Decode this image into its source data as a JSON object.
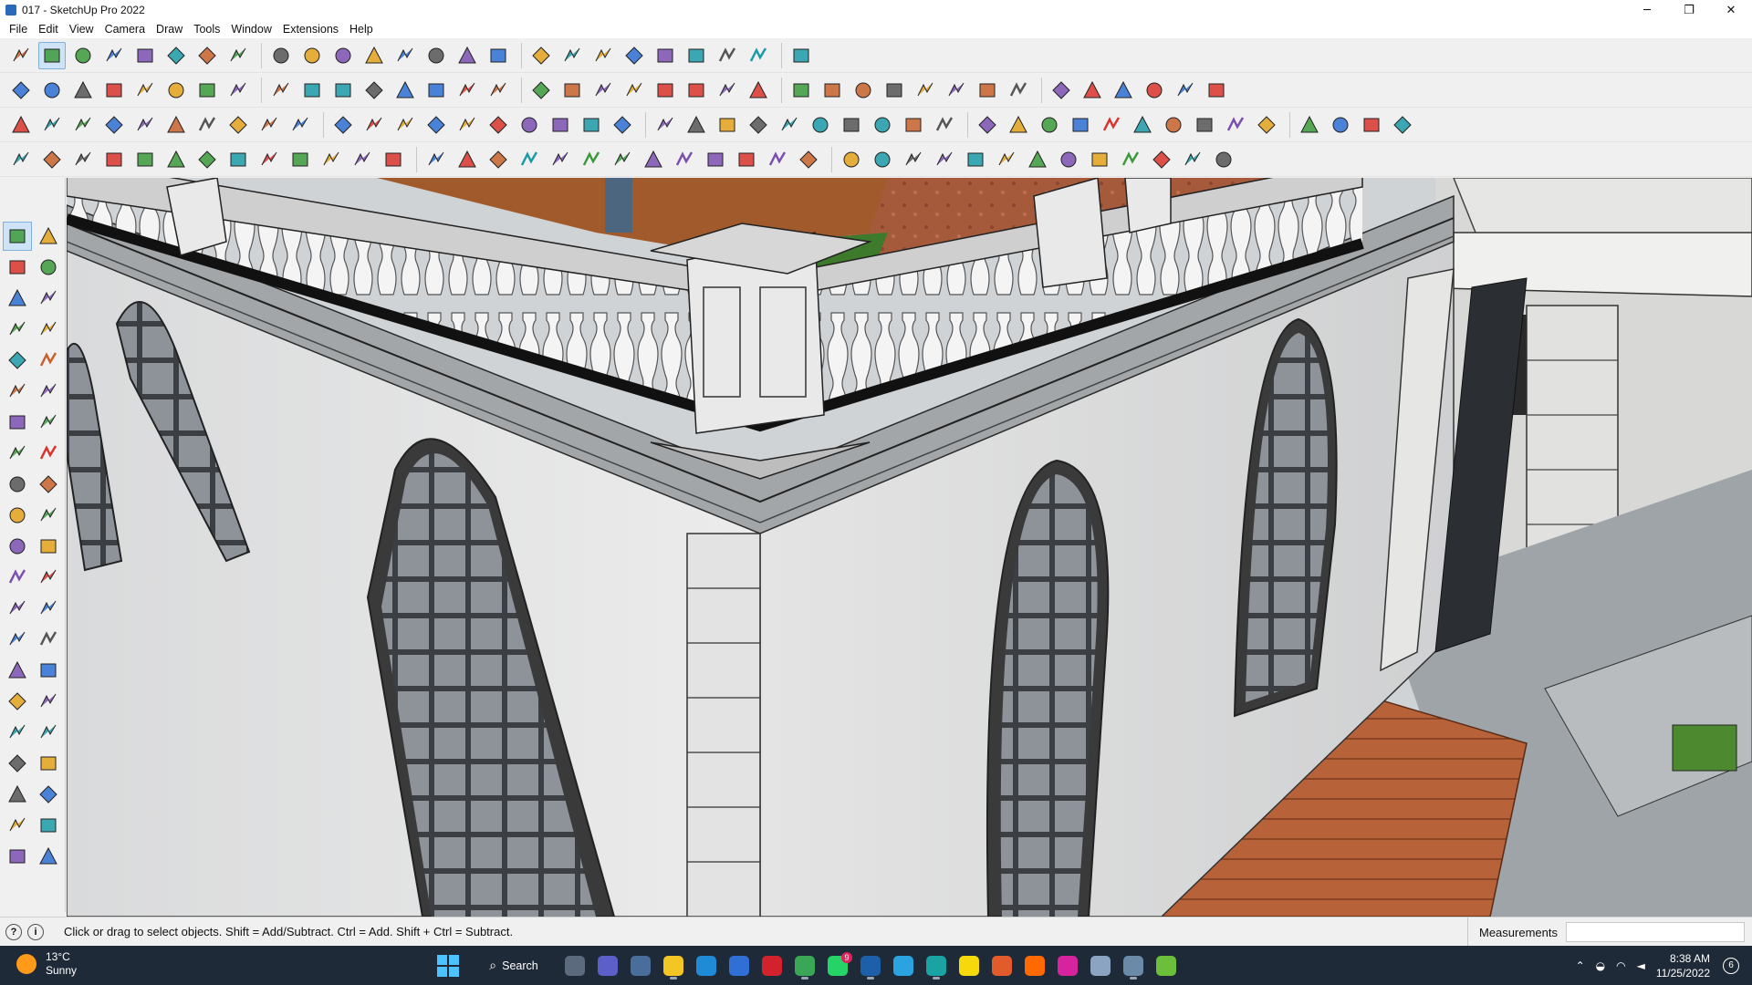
{
  "window": {
    "title": "017 - SketchUp Pro 2022",
    "minimize_glyph": "─",
    "maximize_glyph": "❐",
    "close_glyph": "✕"
  },
  "menu": [
    "File",
    "Edit",
    "View",
    "Camera",
    "Draw",
    "Tools",
    "Window",
    "Extensions",
    "Help"
  ],
  "toolbars": {
    "row1": [
      "search-icon",
      "select-icon",
      "eraser-icon",
      "pencil-icon",
      "arc-icon",
      "rectangle-icon",
      "push-pull-icon",
      "follow-me-icon",
      "move-icon",
      "rotate-icon",
      "scale-icon",
      "tape-measure-icon",
      "text-icon",
      "paint-bucket-icon",
      "orbit-icon",
      "pan-icon",
      "zoom-icon",
      "zoom-extents-icon",
      "warehouse-icon",
      "extension-warehouse-icon",
      "layout-icon",
      "extension-manager-icon",
      "profile-icon",
      "sandbox-icon",
      "dynamic-component-icon"
    ],
    "row2": [
      "iso-view-icon",
      "top-view-icon",
      "front-view-icon",
      "right-view-icon",
      "back-view-icon",
      "left-view-icon",
      "section-plane-icon",
      "xray-icon",
      "wireframe-icon",
      "hidden-line-icon",
      "shaded-icon",
      "textured-icon",
      "monochrome-icon",
      "solid-union-icon",
      "solid-subtract-icon",
      "shape-rect-icon",
      "shape-circle-icon",
      "shape-poly-icon",
      "shape-ellipse-icon",
      "shape-parallelogram-icon",
      "shape-arc-icon",
      "shape-oval-icon",
      "shape-leaf-icon",
      "shape-star-icon",
      "shape-ring-icon",
      "shape-line-icon",
      "shape-eraser-icon",
      "axes-red-icon",
      "axes-green-icon",
      "axes-blue-icon",
      "axes-x-icon",
      "axes-y-icon",
      "axes-z-icon",
      "axes-n-icon",
      "axes-e-icon",
      "axes-f-icon",
      "terrain-icon",
      "tree-icon"
    ],
    "row3": [
      "component-options-icon",
      "component-attributes-icon",
      "generate-report-icon",
      "dimensions-icon",
      "protractor-icon",
      "axes-tool-icon",
      "3d-text-icon",
      "section-fill-icon",
      "outliner-icon",
      "cube-icon",
      "sphere-icon",
      "cylinder-icon",
      "cone-icon",
      "torus-icon",
      "shadows-icon",
      "fog-icon",
      "styles-icon",
      "layers-icon",
      "scenes-icon",
      "camera-icon",
      "match-photo-icon",
      "walk-icon",
      "look-around-icon",
      "position-camera-icon",
      "curve-icon",
      "bezier-icon",
      "spline-icon",
      "tools-a-icon",
      "tools-b-icon",
      "tools-c-icon",
      "tools-d-icon",
      "tools-e-icon",
      "tools-f-icon",
      "tools-g-icon",
      "tools-h-icon",
      "tools-i-icon",
      "tools-j-icon",
      "tools-k-icon",
      "tools-l-icon",
      "tools-m-icon",
      "tools-n-icon",
      "tools-o-icon",
      "tools-p-icon",
      "tools-q-icon"
    ],
    "row4": [
      "stack-blue-icon",
      "stack-cyan-icon",
      "stack-yellow-icon",
      "stack-green-icon",
      "stack-red-icon",
      "stack-white-icon",
      "loop-icon",
      "red-box-icon",
      "table-icon",
      "flag-icon",
      "box-icon",
      "link-icon",
      "curve-tool-icon",
      "path-icon",
      "plus-red-icon",
      "plus-green-icon",
      "cross-blue-icon",
      "cone-tool-icon",
      "fountain-icon",
      "warning-icon",
      "lasso-icon",
      "spin-icon",
      "rotate-tool-icon",
      "move-arrows-icon",
      "bucket-icon",
      "undo-red-icon",
      "fern-icon",
      "group-icon",
      "explode-icon",
      "cluster-icon",
      "gem-icon",
      "organize-icon",
      "panel-icon",
      "grid-a-icon",
      "grid-b-icon",
      "grid-c-icon",
      "scatter-icon",
      "circle-dots-icon",
      "qr-icon"
    ]
  },
  "left_tools": [
    "select-icon",
    "orbit-tool-icon",
    "paint-icon",
    "eraser-icon",
    "component-icon",
    "tag-icon",
    "line-icon",
    "freehand-icon",
    "rectangle-icon",
    "rotated-rect-icon",
    "circle-icon",
    "polygon-icon",
    "arc-icon",
    "pie-icon",
    "two-point-arc-icon",
    "three-point-arc-icon",
    "move-icon",
    "push-pull-icon",
    "rotate-icon",
    "follow-me-icon",
    "scale-icon",
    "offset-icon",
    "tape-icon",
    "dimension-icon",
    "protractor-icon",
    "text-icon",
    "axes-icon",
    "3d-text-icon",
    "orbit-icon",
    "pan-icon",
    "zoom-icon",
    "zoom-window-icon",
    "zoom-extents-icon",
    "previous-icon",
    "position-camera-icon",
    "look-around-icon",
    "walk-icon",
    "section-icon",
    "warehouse-icon",
    "extension-icon",
    "layout-icon",
    "manager-icon"
  ],
  "status": {
    "hint": "Click or drag to select objects. Shift = Add/Subtract. Ctrl = Add. Shift + Ctrl = Subtract.",
    "measurements_label": "Measurements",
    "measurements_value": ""
  },
  "taskbar": {
    "weather_temp": "13°C",
    "weather_text": "Sunny",
    "search_label": "Search",
    "apps": [
      {
        "name": "task-view-icon",
        "color": "#5b6b7d",
        "running": false
      },
      {
        "name": "teams-icon",
        "color": "#5b5fc7",
        "running": false
      },
      {
        "name": "calculator-icon",
        "color": "#4a6e9c",
        "running": false
      },
      {
        "name": "file-explorer-icon",
        "color": "#f3c623",
        "running": true
      },
      {
        "name": "edge-icon",
        "color": "#1f8ad6",
        "running": false
      },
      {
        "name": "store-icon",
        "color": "#2f6fd6",
        "running": false
      },
      {
        "name": "opera-icon",
        "color": "#d2222d",
        "running": false
      },
      {
        "name": "chrome-icon",
        "color": "#3aa757",
        "running": true
      },
      {
        "name": "whatsapp-icon",
        "color": "#25d366",
        "running": false,
        "badge": "9"
      },
      {
        "name": "sketchup-icon",
        "color": "#1d5fa8",
        "running": true
      },
      {
        "name": "telegram-icon",
        "color": "#2aa3e0",
        "running": false
      },
      {
        "name": "app-teal-icon",
        "color": "#1aa3a3",
        "running": true
      },
      {
        "name": "sticky-notes-icon",
        "color": "#f5d90a",
        "running": false
      },
      {
        "name": "grammarly-icon",
        "color": "#e25c2b",
        "running": false
      },
      {
        "name": "soundcloud-icon",
        "color": "#ff6a00",
        "running": false
      },
      {
        "name": "instagram-icon",
        "color": "#d6249f",
        "running": false
      },
      {
        "name": "photos-icon",
        "color": "#8aa4c2",
        "running": false
      },
      {
        "name": "sketchup-layout-icon",
        "color": "#6a8aa8",
        "running": true
      },
      {
        "name": "python-icon",
        "color": "#6cbf3a",
        "running": false
      }
    ],
    "time": "8:38 AM",
    "date": "11/25/2022",
    "notifications": "6"
  },
  "colors": {
    "toolbar_bg": "#f0f0f0",
    "taskbar_bg": "#1f2a38",
    "active_tool": "#cfe3f7"
  }
}
